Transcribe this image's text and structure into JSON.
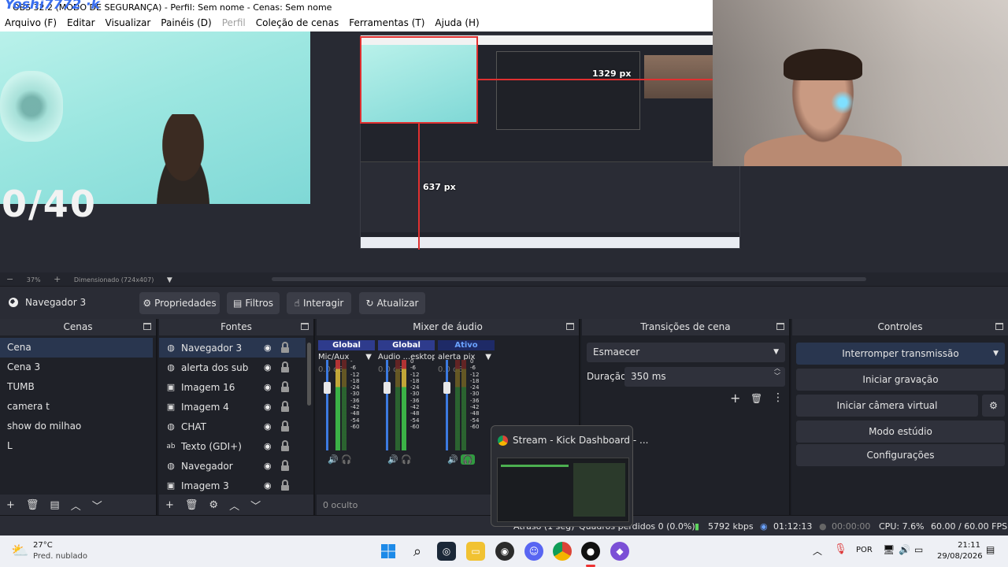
{
  "window": {
    "watermark": "Yoshi7772 ·k",
    "title": "OBS 32.2 (MODO DE SEGURANÇA) - Perfil: Sem nome - Cenas: Sem nome"
  },
  "menu": {
    "items": [
      "Arquivo (F)",
      "Editar",
      "Visualizar",
      "Painéis (D)",
      "Perfil",
      "Coleção de cenas",
      "Ferramentas (T)",
      "Ajuda (H)"
    ],
    "disabled_index": 4
  },
  "preview": {
    "overlay_text": "0/40",
    "guide_h_label": "1329 px",
    "guide_v_label": "637 px"
  },
  "zoom": {
    "minus": "−",
    "level": "37%",
    "plus": "+",
    "size": "Dimensionado (724x407)"
  },
  "source_toolbar": {
    "selected_source": "Navegador 3",
    "props": "Propriedades",
    "filters": "Filtros",
    "interact": "Interagir",
    "refresh": "Atualizar"
  },
  "scenes": {
    "header": "Cenas",
    "items": [
      "Cena",
      "Cena 3",
      "TUMB",
      "camera t",
      "show do milhao",
      "L"
    ],
    "selected": 0
  },
  "sources": {
    "header": "Fontes",
    "items": [
      {
        "name": "Navegador 3",
        "type": "globe"
      },
      {
        "name": "alerta dos sub",
        "type": "globe"
      },
      {
        "name": "Imagem 16",
        "type": "image"
      },
      {
        "name": "Imagem 4",
        "type": "image"
      },
      {
        "name": "CHAT",
        "type": "globe"
      },
      {
        "name": "Texto (GDI+)",
        "type": "text"
      },
      {
        "name": "Navegador",
        "type": "globe"
      },
      {
        "name": "Imagem 3",
        "type": "image"
      }
    ],
    "selected": 0
  },
  "mixer": {
    "header": "Mixer de áudio",
    "hidden_count": "0 oculto",
    "channels": [
      {
        "tag": "Global",
        "name": "Mic/Aux",
        "db": "0.0 dB",
        "tag_color": "#2e3b8c",
        "tag_text": "#ffffff"
      },
      {
        "tag": "Global",
        "name": "Áudio ...esktop",
        "db": "0.0 dB",
        "tag_color": "#2e3b8c",
        "tag_text": "#ffffff"
      },
      {
        "tag": "Ativo",
        "name": "alerta pix",
        "db": "0.0 dB",
        "tag_color": "#1e2a66",
        "tag_text": "#6aa2ff"
      }
    ],
    "scale": [
      "0",
      "-6",
      "-12",
      "-18",
      "-24",
      "-30",
      "-36",
      "-42",
      "-48",
      "-54",
      "-60"
    ],
    "scale_row0": "-",
    "scale_row1": "-6"
  },
  "transitions": {
    "header": "Transições de cena",
    "selected": "Esmaecer",
    "duration_label": "Duração",
    "duration_value": "350 ms"
  },
  "controls": {
    "header": "Controles",
    "stop_stream": "Interromper transmissão",
    "start_recording": "Iniciar gravação",
    "start_virtual_cam": "Iniciar câmera virtual",
    "studio_mode": "Modo estúdio",
    "settings": "Configurações"
  },
  "popup": {
    "title": "Stream - Kick Dashboard - ..."
  },
  "status": {
    "auto": "Atraso (1 seg)",
    "frames": "Quadros perdidos 0 (0.0%)",
    "kbps": "5792 kbps",
    "stream_time": "01:12:13",
    "rec_time": "00:00:00",
    "cpu": "CPU: 7.6%",
    "fps": "60.00 / 60.00 FPS"
  },
  "taskbar": {
    "weather_temp": "27°C",
    "weather_desc": "Pred. nublado",
    "lang": "POR",
    "time": "21:11",
    "date": "29/08/2026"
  },
  "colors": {
    "accent": "#29364f",
    "red_guide": "#e03030",
    "stop_btn": "#29364f"
  }
}
